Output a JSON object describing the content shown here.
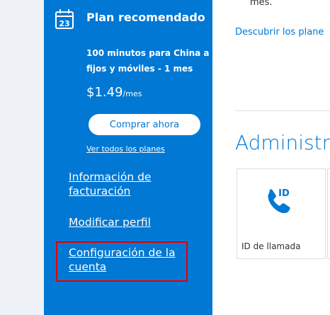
{
  "plan": {
    "title": "Plan recomendado",
    "icon": "calendar-icon",
    "calendar_day": "23",
    "description": "100 minutos para China a fijos y móviles - 1 mes",
    "price": "$1.49",
    "price_unit": "/mes",
    "buy_button": "Comprar ahora",
    "all_plans_link": "Ver todos los planes"
  },
  "sidebar_links": {
    "billing": "Información de facturación",
    "profile": "Modificar perfil",
    "account": "Configuración de la cuenta"
  },
  "main": {
    "fragment_text": "mes.",
    "discover_link": "Descubrir los plane",
    "heading": "Administra",
    "cards": [
      {
        "label": "ID de llamada",
        "icon": "caller-id-icon",
        "icon_text": "ID"
      }
    ]
  },
  "colors": {
    "brand_blue": "#0078d4",
    "highlight_red": "#e00000"
  }
}
